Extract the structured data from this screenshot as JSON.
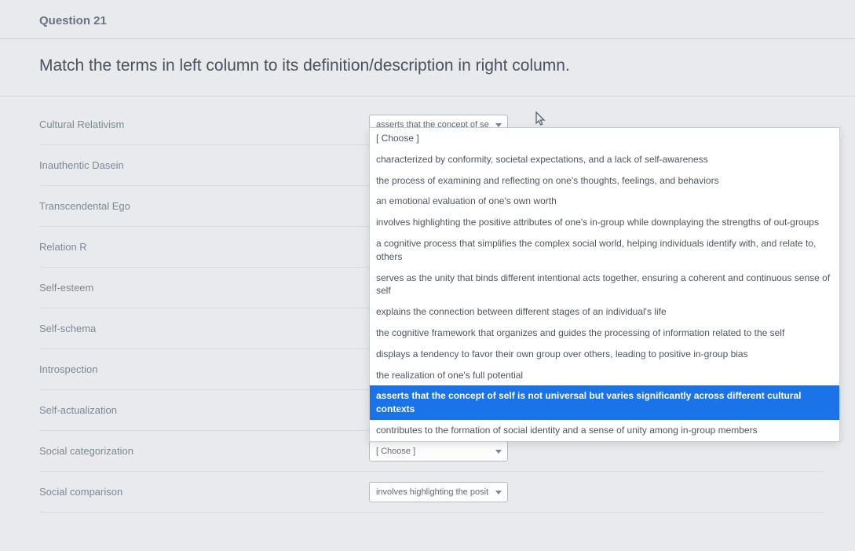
{
  "question_label": "Question 21",
  "instruction": "Match the terms in left column to its definition/description in right column.",
  "placeholder": "[ Choose ]",
  "terms": [
    {
      "name": "Cultural Relativism",
      "value": "asserts that the concept of se"
    },
    {
      "name": "Inauthentic Dasein",
      "value": ""
    },
    {
      "name": "Transcendental Ego",
      "value": ""
    },
    {
      "name": "Relation R",
      "value": ""
    },
    {
      "name": "Self-esteem",
      "value": ""
    },
    {
      "name": "Self-schema",
      "value": "",
      "faded": true
    },
    {
      "name": "Introspection",
      "value": ""
    },
    {
      "name": "Self-actualization",
      "value": ""
    },
    {
      "name": "Social categorization",
      "value": ""
    },
    {
      "name": "Social comparison",
      "value": "involves highlighting the posit"
    }
  ],
  "dropdown": {
    "options": [
      "[ Choose ]",
      "characterized by conformity, societal expectations, and a lack of self-awareness",
      "the process of examining and reflecting on one's thoughts, feelings, and behaviors",
      "an emotional evaluation of one's own worth",
      "involves highlighting the positive attributes of one's in-group while downplaying the strengths of out-groups",
      "a cognitive process that simplifies the complex social world, helping individuals identify with, and relate to, others",
      "serves as the unity that binds different intentional acts together, ensuring a coherent and continuous sense of self",
      "explains the connection between different stages of an individual's life",
      "the cognitive framework that organizes and guides the processing of information related to the self",
      "displays a tendency to favor their own group over others, leading to positive in-group bias",
      "the realization of one's full potential",
      "asserts that the concept of self is not universal but varies significantly across different cultural contexts",
      "contributes to the formation of social identity and a sense of unity among in-group members"
    ],
    "highlighted_index": 11
  }
}
